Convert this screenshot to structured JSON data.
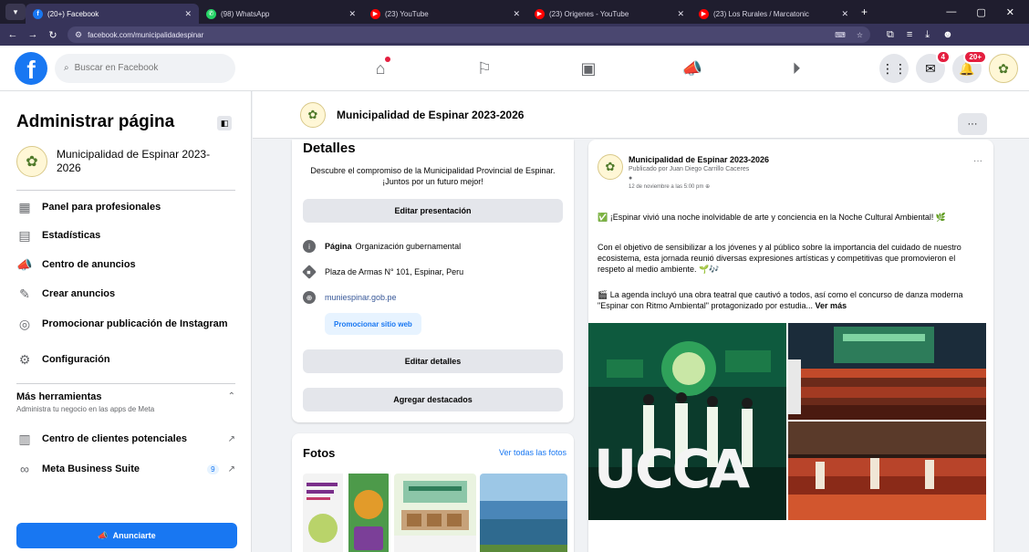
{
  "browser": {
    "tabs": [
      {
        "title": "(20+) Facebook",
        "color": "#1877f2",
        "glyph": "f",
        "active": true
      },
      {
        "title": "(98) WhatsApp",
        "color": "#25d366",
        "glyph": "✆",
        "active": false
      },
      {
        "title": "(23) YouTube",
        "color": "#ff0000",
        "glyph": "▶",
        "active": false
      },
      {
        "title": "(23) Origenes - YouTube",
        "color": "#ff0000",
        "glyph": "▶",
        "active": false
      },
      {
        "title": "(23) Los Rurales / Marcatonic",
        "color": "#ff0000",
        "glyph": "▶",
        "active": false
      }
    ],
    "url": "facebook.com/municipalidadespinar"
  },
  "fbnav": {
    "search_placeholder": "Buscar en Facebook",
    "messenger_badge": "4",
    "notifications_badge": "20+"
  },
  "sidebar": {
    "title": "Administrar página",
    "page_name": "Municipalidad de Espinar 2023-2026",
    "items": [
      {
        "label": "Panel para profesionales",
        "icon": "dashboard-icon"
      },
      {
        "label": "Estadísticas",
        "icon": "chart-icon"
      },
      {
        "label": "Centro de anuncios",
        "icon": "megaphone-icon"
      },
      {
        "label": "Crear anuncios",
        "icon": "pencil-icon"
      },
      {
        "label": "Promocionar publicación de Instagram",
        "icon": "instagram-icon"
      },
      {
        "label": "Configuración",
        "icon": "gear-icon"
      }
    ],
    "more_tools": {
      "title": "Más herramientas",
      "subtitle": "Administra tu negocio en las apps de Meta"
    },
    "tools": [
      {
        "label": "Centro de clientes potenciales",
        "icon": "leads-icon",
        "count": ""
      },
      {
        "label": "Meta Business Suite",
        "icon": "meta-icon",
        "count": "9"
      }
    ],
    "promote_label": "Anunciarte"
  },
  "header": {
    "page_title": "Municipalidad de Espinar 2023-2026"
  },
  "details": {
    "heading": "Detalles",
    "description": "Descubre el compromiso de la Municipalidad Provincial de Espinar. ¡Juntos por un futuro mejor!",
    "edit_presentation": "Editar presentación",
    "page_label": "Página",
    "page_category": "Organización gubernamental",
    "address": "Plaza de Armas N° 101, Espinar, Peru",
    "website": "muniespinar.gob.pe",
    "promote_site": "Promocionar sitio web",
    "edit_details": "Editar detalles",
    "add_featured": "Agregar destacados"
  },
  "photos": {
    "heading": "Fotos",
    "see_all": "Ver todas las fotos"
  },
  "post": {
    "page_name": "Municipalidad de Espinar 2023-2026",
    "published_by": "Publicado por Juan Diego Carrillo Caceres",
    "date": "12 de noviembre a las 5:00 pm",
    "p1": "✅ ¡Espinar vivió una noche inolvidable de arte y conciencia en la Noche Cultural Ambiental! 🌿",
    "p2": "Con el objetivo de sensibilizar a los jóvenes y al público sobre la importancia del cuidado de nuestro ecosistema, esta jornada reunió diversas expresiones artísticas y competitivas que promovieron el respeto al medio ambiente. 🌱🎶",
    "p3": "🎬 La agenda incluyó una obra teatral que cautivó a todos, así como el concurso de danza moderna \"Espinar con Ritmo Ambiental\" protagonizado por estudia...",
    "see_more": "Ver más",
    "image_text": "UCCA"
  }
}
